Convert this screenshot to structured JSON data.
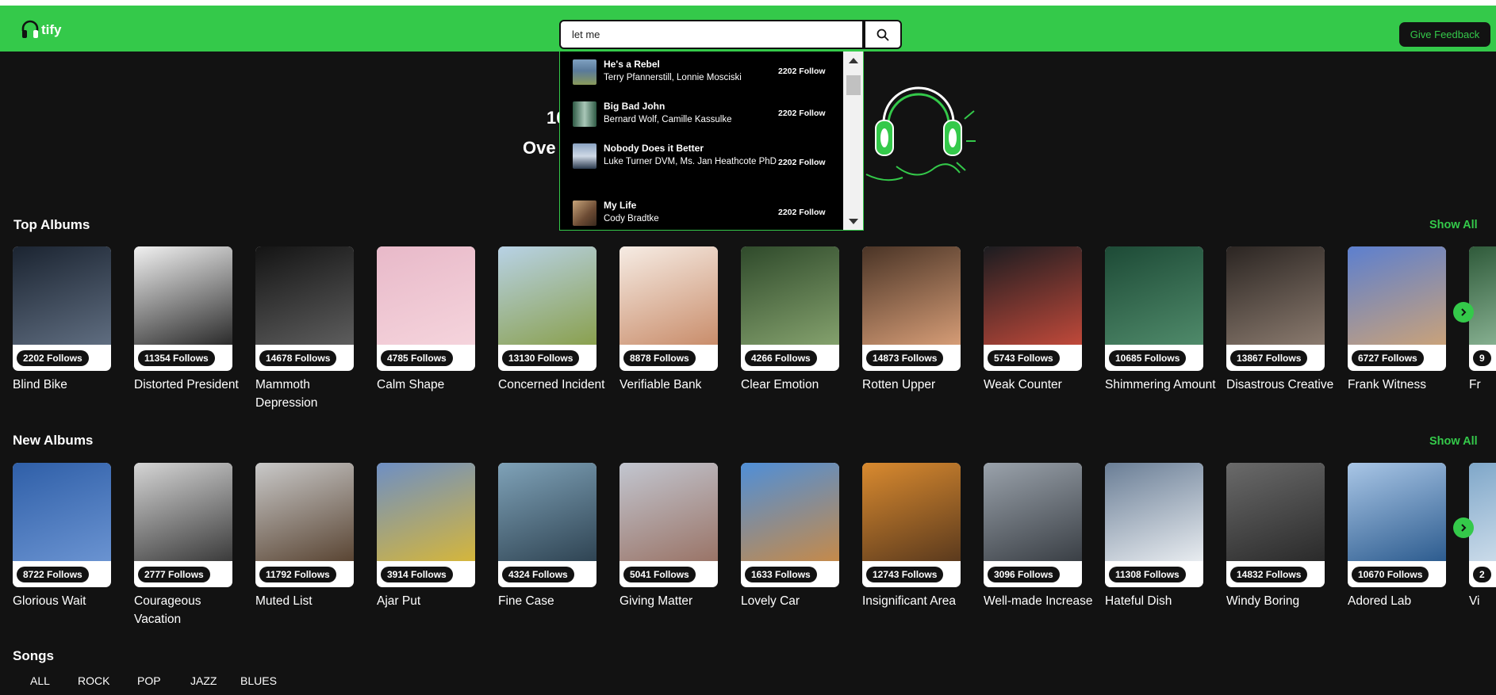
{
  "app": {
    "logo_text": "tify",
    "logo_icon": "headphones-icon"
  },
  "navbar": {
    "search_value": "let me",
    "search_icon": "search-icon",
    "feedback_label": "Give Feedback"
  },
  "hero": {
    "line1": "10",
    "line2": "Ove"
  },
  "search_results": [
    {
      "title": "He's a Rebel",
      "artist": "Terry Pfannerstill, Lonnie Mosciski",
      "follows": "2202 Follow",
      "thumb_colors": [
        "#5a7a9a",
        "#7a8a5a"
      ]
    },
    {
      "title": "Big Bad John",
      "artist": "Bernard Wolf, Camille Kassulke",
      "follows": "2202 Follow",
      "thumb_colors": [
        "#2f5a45",
        "#a9c7b8"
      ]
    },
    {
      "title": "Nobody Does it Better",
      "artist": "Luke Turner DVM, Ms. Jan Heathcote PhD",
      "follows": "2202 Follow",
      "thumb_colors": [
        "#8aa3c2",
        "#2b3a4e"
      ]
    },
    {
      "title": "My Life",
      "artist": "Cody Bradtke",
      "follows": "2202 Follow",
      "thumb_colors": [
        "#6b4a33",
        "#c7a47a"
      ]
    }
  ],
  "top_albums": {
    "title": "Top Albums",
    "show_all": "Show All",
    "items": [
      {
        "name": "Blind Bike",
        "follows": "2202 Follows",
        "colors": [
          "#1b2431",
          "#5f6d80"
        ]
      },
      {
        "name": "Distorted President",
        "follows": "11354 Follows",
        "colors": [
          "#f1f1f1",
          "#2b2b2b"
        ]
      },
      {
        "name": "Mammoth Depression",
        "follows": "14678 Follows",
        "colors": [
          "#141414",
          "#5d5d5d"
        ]
      },
      {
        "name": "Calm Shape",
        "follows": "4785 Follows",
        "colors": [
          "#e8b9c9",
          "#f5d4dc"
        ]
      },
      {
        "name": "Concerned Incident",
        "follows": "13130 Follows",
        "colors": [
          "#b8d2e6",
          "#8aa04e"
        ]
      },
      {
        "name": "Verifiable Bank",
        "follows": "8878 Follows",
        "colors": [
          "#f6ece4",
          "#c98d6b"
        ]
      },
      {
        "name": "Clear Emotion",
        "follows": "4266 Follows",
        "colors": [
          "#2f4a2b",
          "#84a16d"
        ]
      },
      {
        "name": "Rotten Upper",
        "follows": "14873 Follows",
        "colors": [
          "#4a3426",
          "#d59c76"
        ]
      },
      {
        "name": "Weak Counter",
        "follows": "5743 Follows",
        "colors": [
          "#1b1c20",
          "#c0493a"
        ]
      },
      {
        "name": "Shimmering Amount",
        "follows": "10685 Follows",
        "colors": [
          "#1d4a36",
          "#4f8a6a"
        ]
      },
      {
        "name": "Disastrous Creative",
        "follows": "13867 Follows",
        "colors": [
          "#2b2522",
          "#8a7a6e"
        ]
      },
      {
        "name": "Frank Witness",
        "follows": "6727 Follows",
        "colors": [
          "#5c7fcf",
          "#c9a27a"
        ]
      },
      {
        "name": "Fr",
        "follows": "9",
        "colors": [
          "#2f5a3a",
          "#9ac3a4"
        ]
      }
    ]
  },
  "new_albums": {
    "title": "New Albums",
    "show_all": "Show All",
    "items": [
      {
        "name": "Glorious Wait",
        "follows": "8722 Follows",
        "colors": [
          "#2f5fa8",
          "#6a93d1"
        ]
      },
      {
        "name": "Courageous Vacation",
        "follows": "2777 Follows",
        "colors": [
          "#d5d5d5",
          "#3b3b3b"
        ]
      },
      {
        "name": "Muted List",
        "follows": "11792 Follows",
        "colors": [
          "#c9c9c9",
          "#5a4533"
        ]
      },
      {
        "name": "Ajar Put",
        "follows": "3914 Follows",
        "colors": [
          "#6e8fc4",
          "#d5b63b"
        ]
      },
      {
        "name": "Fine Case",
        "follows": "4324 Follows",
        "colors": [
          "#7fa2b8",
          "#2f4453"
        ]
      },
      {
        "name": "Giving Matter",
        "follows": "5041 Follows",
        "colors": [
          "#c2c6d0",
          "#9a7467"
        ]
      },
      {
        "name": "Lovely Car",
        "follows": "1633 Follows",
        "colors": [
          "#4f8fd8",
          "#c58a4a"
        ]
      },
      {
        "name": "Insignificant Area",
        "follows": "12743 Follows",
        "colors": [
          "#d98a2f",
          "#5b3a1d"
        ]
      },
      {
        "name": "Well-made Increase",
        "follows": "3096 Follows",
        "colors": [
          "#9aa2ab",
          "#3a3f45"
        ]
      },
      {
        "name": "Hateful Dish",
        "follows": "11308 Follows",
        "colors": [
          "#6a7e96",
          "#e8ecf0"
        ]
      },
      {
        "name": "Windy Boring",
        "follows": "14832 Follows",
        "colors": [
          "#6a6a6a",
          "#2a2a2a"
        ]
      },
      {
        "name": "Adored Lab",
        "follows": "10670 Follows",
        "colors": [
          "#a9c6e6",
          "#2d5c8f"
        ]
      },
      {
        "name": "Vi",
        "follows": "2",
        "colors": [
          "#7fa7c9",
          "#dce7f1"
        ]
      }
    ]
  },
  "songs": {
    "title": "Songs",
    "tabs": [
      "ALL",
      "ROCK",
      "POP",
      "JAZZ",
      "BLUES"
    ]
  },
  "colors": {
    "accent": "#34c94a",
    "background": "#121212"
  }
}
